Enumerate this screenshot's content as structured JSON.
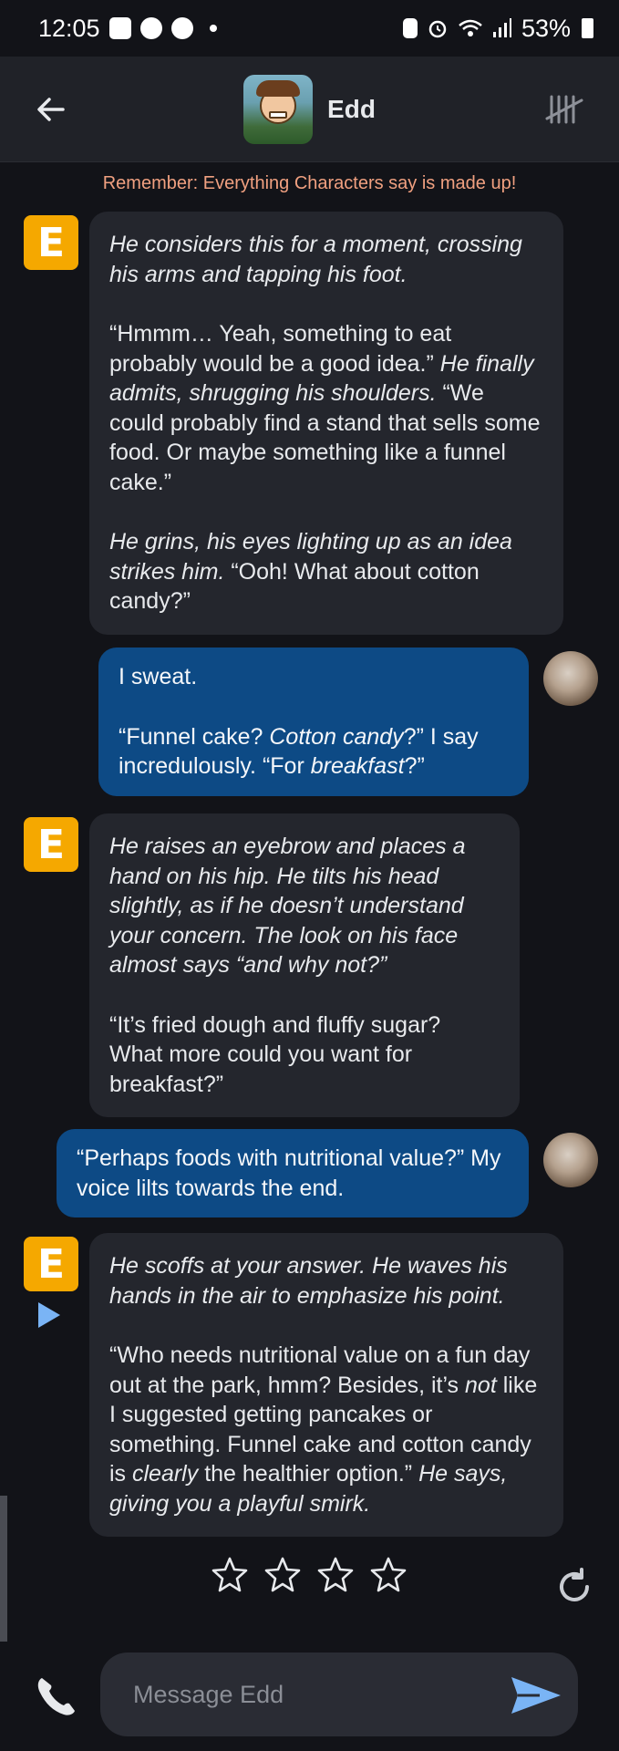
{
  "status_bar": {
    "time": "12:05",
    "battery": "53%",
    "icons": [
      "gallery-icon",
      "line-icon",
      "pinterest-icon",
      "dot-icon",
      "battery-saver-icon",
      "alarm-icon",
      "wifi-icon",
      "signal-icon",
      "battery-icon"
    ]
  },
  "header": {
    "back_icon": "arrow-left-icon",
    "character_name": "Edd",
    "menu_icon": "tally-marks-icon"
  },
  "notice": "Remember: Everything Characters say is made up!",
  "messages": [
    {
      "role": "bot",
      "avatar_letter": "E",
      "paragraphs": [
        [
          {
            "t": "He considers this for a moment, crossing his arms and tapping his foot.",
            "i": true
          }
        ],
        [
          {
            "t": "“Hmmm… Yeah, something to eat probably would be a good idea.” ",
            "i": false
          },
          {
            "t": "He finally admits, shrugging his shoulders.",
            "i": true
          },
          {
            "t": " “We could probably find a stand that sells some food. Or maybe something like a funnel cake.”",
            "i": false
          }
        ],
        [
          {
            "t": "He grins, his eyes lighting up as an idea strikes him.",
            "i": true
          },
          {
            "t": " “Ooh! What about cotton candy?”",
            "i": false
          }
        ]
      ]
    },
    {
      "role": "user",
      "paragraphs": [
        [
          {
            "t": "I sweat.",
            "i": false
          }
        ],
        [
          {
            "t": "“Funnel cake? ",
            "i": false
          },
          {
            "t": "Cotton candy",
            "i": true
          },
          {
            "t": "?” I say incredulously. “For ",
            "i": false
          },
          {
            "t": "breakfast",
            "i": true
          },
          {
            "t": "?”",
            "i": false
          }
        ]
      ]
    },
    {
      "role": "bot",
      "avatar_letter": "E",
      "paragraphs": [
        [
          {
            "t": "He raises an eyebrow and places a hand on his hip. He tilts his head slightly, as if he doesn’t understand your concern. The look on his face almost says “and why not?”",
            "i": true
          }
        ],
        [
          {
            "t": "“It’s fried dough and fluffy sugar? What more could you want for breakfast?”",
            "i": false
          }
        ]
      ]
    },
    {
      "role": "user",
      "paragraphs": [
        [
          {
            "t": "“Perhaps foods with nutritional value?” My voice lilts towards the end.",
            "i": false
          }
        ]
      ]
    },
    {
      "role": "bot",
      "avatar_letter": "E",
      "paragraphs": [
        [
          {
            "t": "He scoffs at your answer. He waves his hands in the air to emphasize his point.",
            "i": true
          }
        ],
        [
          {
            "t": "“Who needs nutritional value on a fun day out at the park, hmm? Besides, it’s ",
            "i": false
          },
          {
            "t": "not",
            "i": true
          },
          {
            "t": " like I suggested getting pancakes or something. Funnel cake and cotton candy is ",
            "i": false
          },
          {
            "t": "clearly",
            "i": true
          },
          {
            "t": " the healthier option.” ",
            "i": false
          },
          {
            "t": "He says, giving you a playful smirk.",
            "i": true
          }
        ]
      ]
    }
  ],
  "rating": {
    "stars_total": 4,
    "stars_filled": 0
  },
  "controls": {
    "play_icon": "play-icon",
    "regenerate_icon": "refresh-icon",
    "call_icon": "phone-icon",
    "send_icon": "send-icon"
  },
  "composer": {
    "placeholder": "Message Edd",
    "value": ""
  },
  "colors": {
    "background": "#121318",
    "header": "#202228",
    "bot_bubble": "#24262d",
    "user_bubble": "#0d4a85",
    "bot_avatar": "#f5a800",
    "notice": "#f0a080",
    "accent": "#7ab4f5"
  }
}
